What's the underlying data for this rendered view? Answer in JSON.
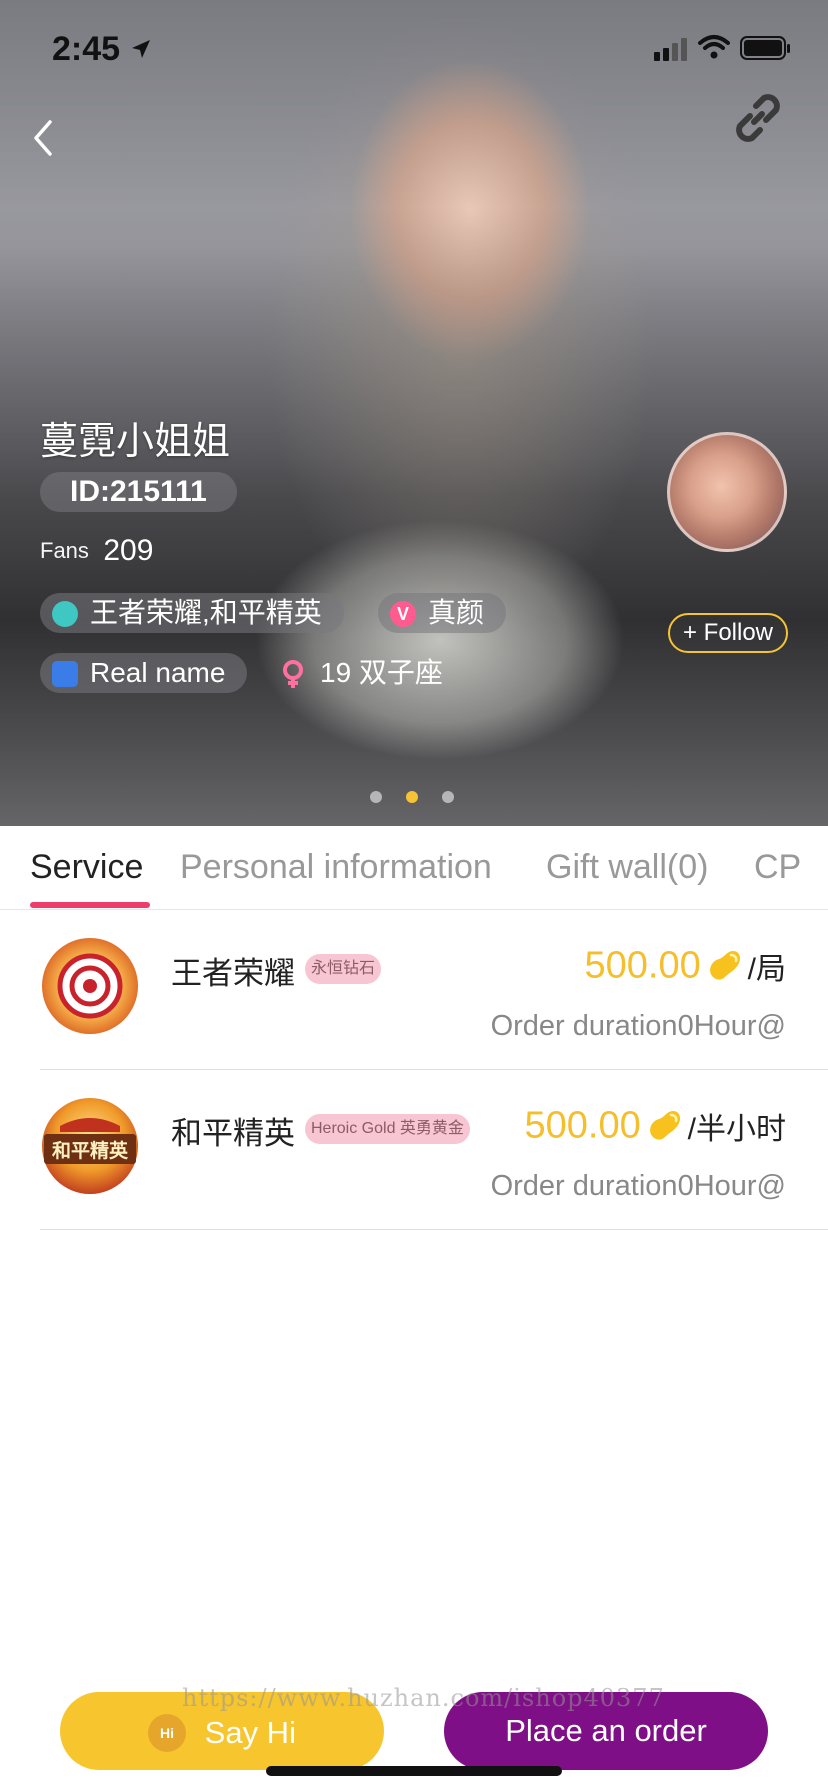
{
  "status_bar": {
    "time": "2:45"
  },
  "profile": {
    "nickname": "蔓霓小姐姐",
    "id_label": "ID:215111",
    "fans_label": "Fans",
    "fans_count": "209",
    "tags": {
      "games": "王者荣耀,和平精英",
      "real_face": "真颜",
      "real_face_badge": "V",
      "real_name": "Real name",
      "age_zodiac": "19 双子座"
    },
    "follow_label": "+ Follow",
    "carousel": {
      "count": 3,
      "active_index": 1
    }
  },
  "tabs": [
    {
      "label": "Service"
    },
    {
      "label": "Personal information"
    },
    {
      "label": "Gift wall(0)"
    },
    {
      "label": "CP"
    }
  ],
  "active_tab": "Service",
  "services": [
    {
      "name": "王者荣耀",
      "rank": "永恒钻石",
      "price": "500.00",
      "unit": "/局",
      "duration": "Order duration0Hour@",
      "icon": "honor-of-kings-icon"
    },
    {
      "name": "和平精英",
      "rank": "Heroic Gold 英勇黄金",
      "price": "500.00",
      "unit": "/半小时",
      "duration": "Order duration0Hour@",
      "icon": "peacekeeper-elite-icon",
      "icon_text": "和平精英"
    }
  ],
  "actions": {
    "say_hi_badge": "Hi",
    "say_hi": "Say Hi",
    "place_order": "Place an order"
  },
  "watermark": "https://www.huzhan.com/ishop40377",
  "colors": {
    "accent_gold": "#f5be2c",
    "order_purple": "#7e0f86",
    "tab_underline": "#ee3d6b"
  }
}
